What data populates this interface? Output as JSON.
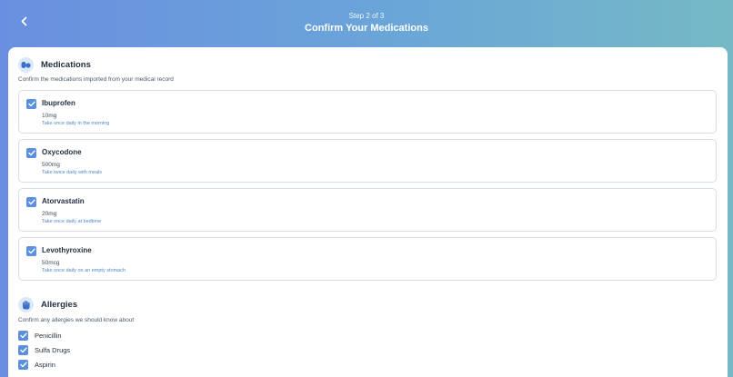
{
  "header": {
    "step": "Step 2 of 3",
    "title": "Confirm Your Medications",
    "back_icon": "chevron-left-icon"
  },
  "medications": {
    "title": "Medications",
    "subtitle": "Confirm the medications imported from your medical record",
    "icon": "pills-icon",
    "items": [
      {
        "name": "Ibuprofen",
        "dose": "10mg",
        "instructions": "Take once daily in the morning",
        "checked": true
      },
      {
        "name": "Oxycodone",
        "dose": "500mg",
        "instructions": "Take twice daily with meals",
        "checked": true
      },
      {
        "name": "Atorvastatin",
        "dose": "20mg",
        "instructions": "Take once daily at bedtime",
        "checked": true
      },
      {
        "name": "Levothyroxine",
        "dose": "50mcg",
        "instructions": "Take once daily on an empty stomach",
        "checked": true
      }
    ]
  },
  "allergies": {
    "title": "Allergies",
    "subtitle": "Confirm any allergies we should know about",
    "icon": "hand-icon",
    "items": [
      {
        "name": "Penicillin",
        "checked": true
      },
      {
        "name": "Sulfa Drugs",
        "checked": true
      },
      {
        "name": "Aspirin",
        "checked": true
      }
    ]
  },
  "colors": {
    "accent": "#5b8fe0",
    "instruction_text": "#4d88cc"
  }
}
